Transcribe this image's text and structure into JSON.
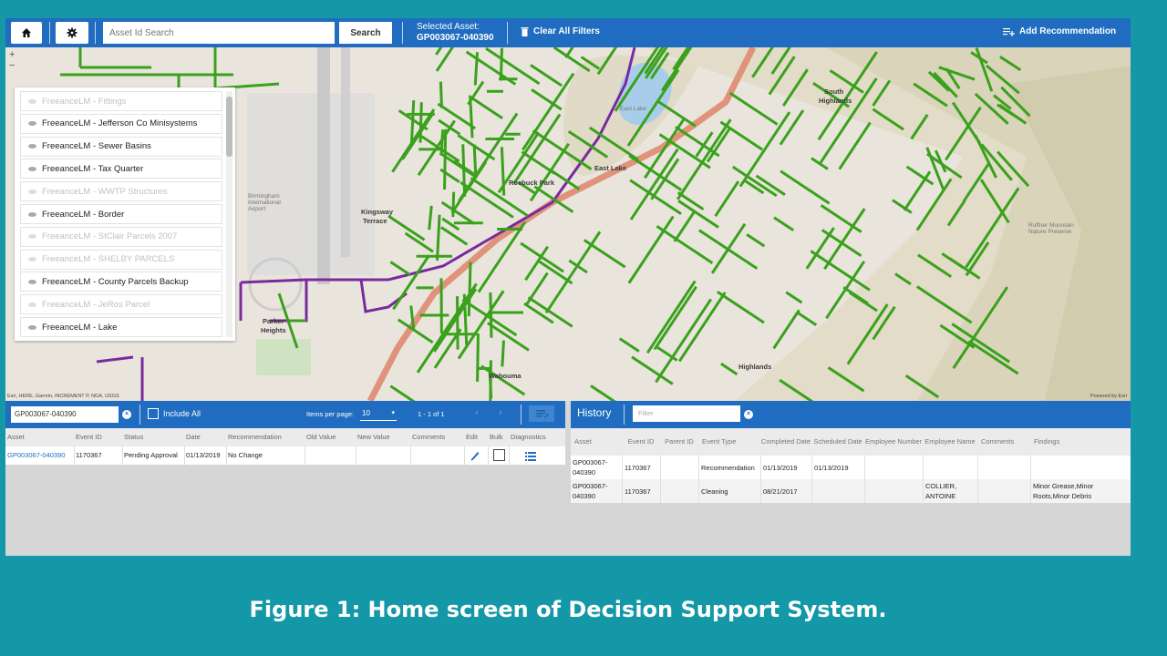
{
  "toolbar": {
    "search_placeholder": "Asset Id Search",
    "search_label": "Search",
    "selected_asset_label": "Selected Asset:",
    "selected_asset_value": "GP003067-040390",
    "clear_filters_label": "Clear All Filters",
    "add_recommendation_label": "Add Recommendation"
  },
  "map": {
    "layers": [
      {
        "label": "FreeanceLM - Fittings",
        "visible": false
      },
      {
        "label": "FreeanceLM - Jefferson Co Minisystems",
        "visible": true
      },
      {
        "label": "FreeanceLM - Sewer Basins",
        "visible": true
      },
      {
        "label": "FreeanceLM - Tax Quarter",
        "visible": true
      },
      {
        "label": "FreeanceLM - WWTP Structures",
        "visible": false
      },
      {
        "label": "FreeanceLM - Border",
        "visible": true
      },
      {
        "label": "FreeanceLM - StClair Parcels 2007",
        "visible": false
      },
      {
        "label": "FreeanceLM - SHELBY PARCELS",
        "visible": false
      },
      {
        "label": "FreeanceLM - County Parcels Backup",
        "visible": true
      },
      {
        "label": "FreeanceLM - JeRos Parcel",
        "visible": false
      },
      {
        "label": "FreeanceLM - Lake",
        "visible": true
      }
    ],
    "labels": {
      "east_lake": "East Lake",
      "kingsway": "Kingsway",
      "terrace": "Terrace",
      "parker": "Parker",
      "heights": "Heights",
      "south": "South",
      "highlands": "Highlands",
      "wahouma": "Wahouma",
      "roebuck_park": "Roebuck Park",
      "airport": "Birmingham International Airport",
      "ruffner": "Ruffner Mountain Nature Preserve",
      "east_lake_small": "East Lake",
      "cen_highlands": "Highlands"
    },
    "attribution": "Esri, HERE, Garmin, INCREMENT P, NGA, USGS",
    "powered_by": "Powered by Esri",
    "colors": {
      "sewer": "#3aa11d",
      "boundary": "#7a2a9e",
      "highway": "#e0937a",
      "lake": "#a8cdea"
    }
  },
  "events_panel": {
    "asset_filter_value": "GP003067-040390",
    "include_all_label": "Include All",
    "items_per_page_label": "Items per page:",
    "items_per_page_value": "10",
    "page_range": "1 - 1 of 1",
    "columns": [
      "Asset",
      "Event ID",
      "Status",
      "Date",
      "Recommendation",
      "Old Value",
      "New Value",
      "Comments",
      "Edit",
      "Bulk",
      "Diagnostics"
    ],
    "rows": [
      {
        "asset": "GP003067-040390",
        "event_id": "1170367",
        "status": "Pending Approval",
        "date": "01/13/2019",
        "recommendation": "No Change",
        "old_value": "",
        "new_value": "",
        "comments": ""
      }
    ]
  },
  "history_panel": {
    "title": "History",
    "filter_placeholder": "Filter",
    "columns": [
      "Asset",
      "Event ID",
      "Parent ID",
      "Event Type",
      "Completed Date",
      "Scheduled Date",
      "Employee Number",
      "Employee Name",
      "Comments",
      "Findings"
    ],
    "rows": [
      {
        "asset": "GP003067-040390",
        "event_id": "1170367",
        "parent_id": "",
        "event_type": "Recommendation",
        "completed_date": "01/13/2019",
        "scheduled_date": "01/13/2019",
        "employee_number": "",
        "employee_name": "",
        "comments": "",
        "findings": ""
      },
      {
        "asset": "GP003067-040390",
        "event_id": "1170367",
        "parent_id": "",
        "event_type": "Cleaning",
        "completed_date": "08/21/2017",
        "scheduled_date": "",
        "employee_number": "",
        "employee_name": "COLLIER, ANTOINE",
        "comments": "",
        "findings": "Minor Grease,Minor Roots,Minor Debris"
      }
    ]
  },
  "caption": "Figure 1: Home screen of Decision Support System."
}
